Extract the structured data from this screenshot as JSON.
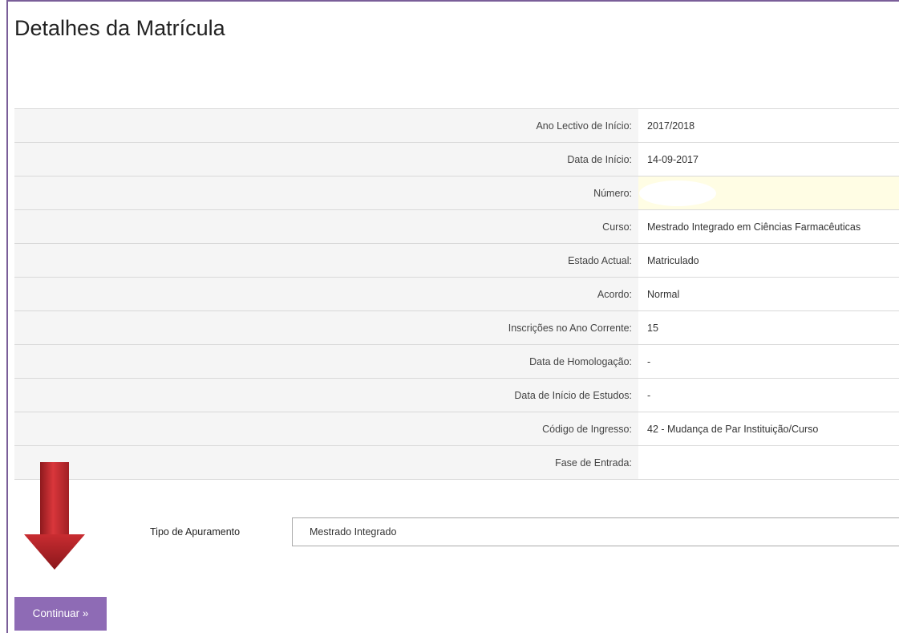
{
  "page": {
    "title": "Detalhes da Matrícula"
  },
  "details": {
    "rows": [
      {
        "label": "Ano Lectivo de Início:",
        "value": "2017/2018"
      },
      {
        "label": "Data de Início:",
        "value": "14-09-2017"
      },
      {
        "label": "Número:",
        "value": ""
      },
      {
        "label": "Curso:",
        "value": "Mestrado Integrado em Ciências Farmacêuticas"
      },
      {
        "label": "Estado Actual:",
        "value": "Matriculado"
      },
      {
        "label": "Acordo:",
        "value": "Normal"
      },
      {
        "label": "Inscrições no Ano Corrente:",
        "value": "15"
      },
      {
        "label": "Data de Homologação:",
        "value": "-"
      },
      {
        "label": "Data de Início de Estudos:",
        "value": "-"
      },
      {
        "label": "Código de Ingresso:",
        "value": "42 - Mudança de Par Instituição/Curso"
      },
      {
        "label": "Fase de Entrada:",
        "value": ""
      }
    ]
  },
  "form": {
    "tipo_label": "Tipo de Apuramento",
    "tipo_value": "Mestrado Integrado",
    "continue_label": "Continuar »"
  },
  "colors": {
    "accent": "#8e6bb5",
    "frame": "#7a5e99",
    "arrow": "#c0282d",
    "highlight": "#fffde4"
  }
}
